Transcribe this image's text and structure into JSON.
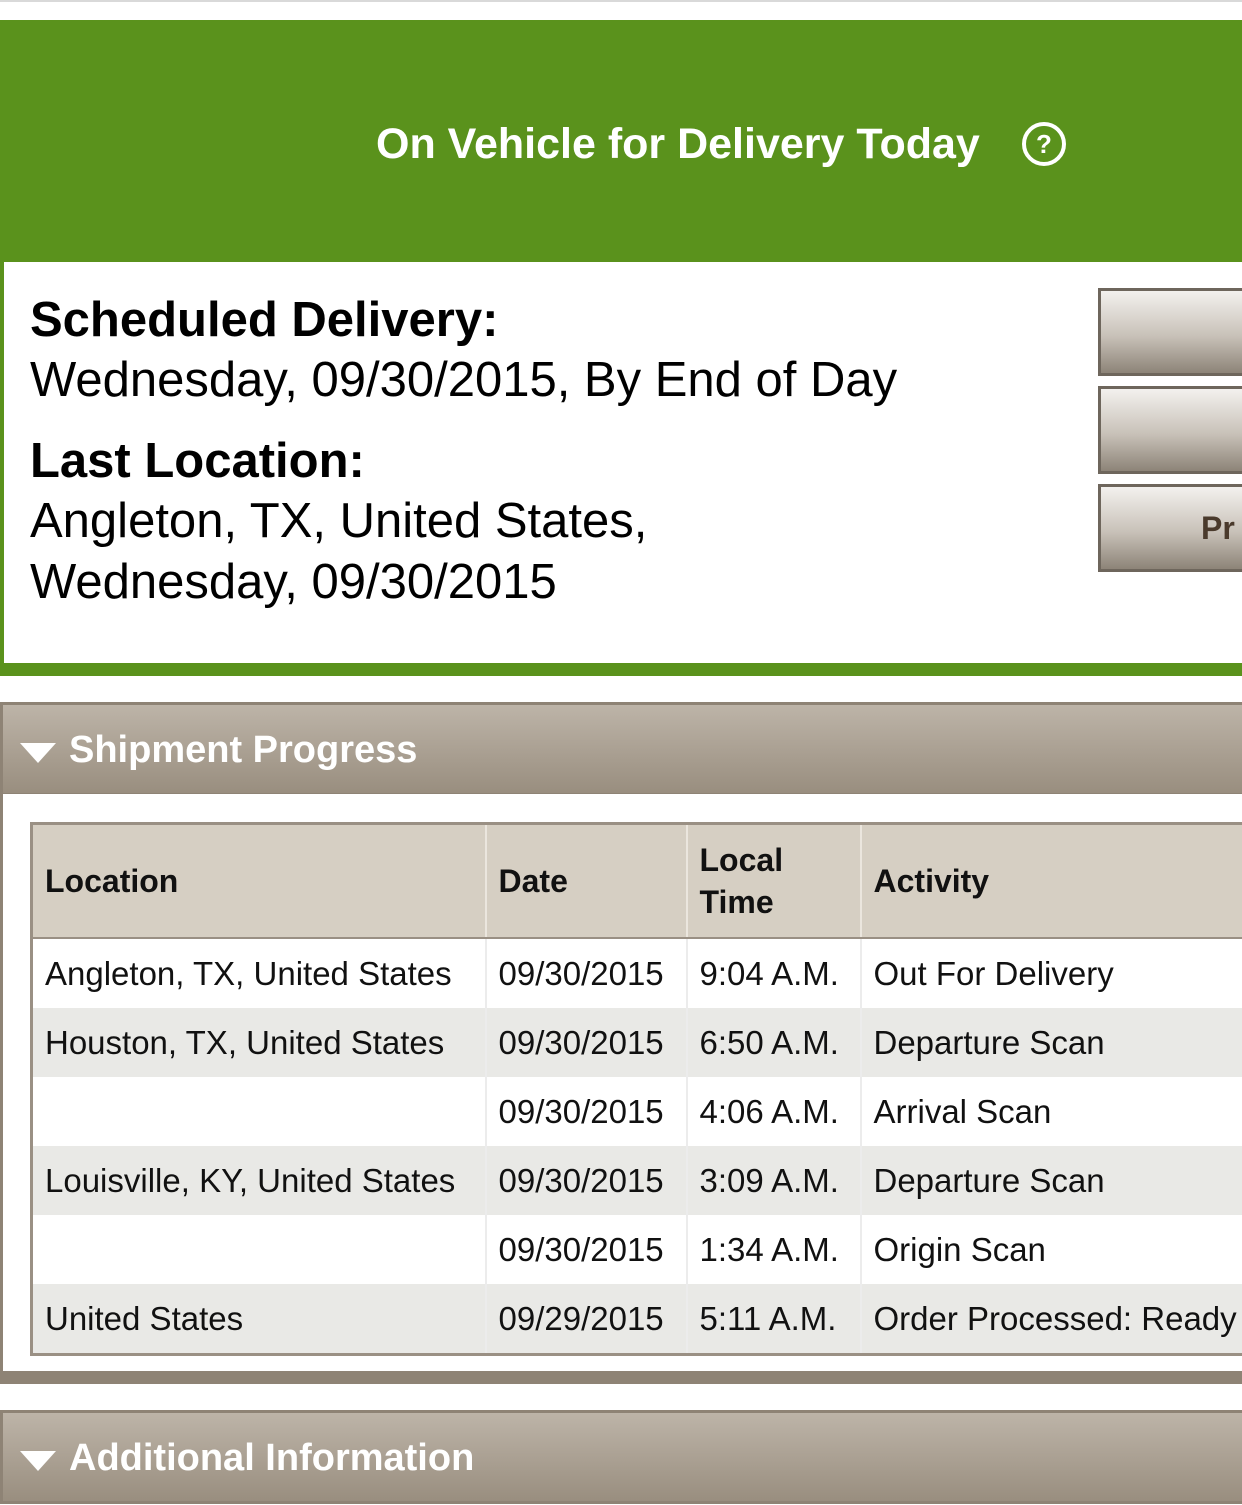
{
  "status": {
    "title": "On Vehicle for Delivery Today",
    "help_icon": "question-circle-icon",
    "accent_color": "#5a921c"
  },
  "delivery": {
    "scheduled_label": "Scheduled Delivery:",
    "scheduled_value": "Wednesday, 09/30/2015, By End of Day",
    "last_location_label": "Last Location:",
    "last_location_line1": "Angleton, TX, United States,",
    "last_location_line2": "Wednesday, 09/30/2015"
  },
  "side_buttons": [
    "",
    "",
    "Pr"
  ],
  "shipment_progress": {
    "title": "Shipment Progress",
    "columns": [
      "Location",
      "Date",
      "Local Time",
      "Activity"
    ],
    "rows": [
      {
        "location": "Angleton, TX, United States",
        "date": "09/30/2015",
        "time": "9:04 A.M.",
        "activity": "Out For Delivery"
      },
      {
        "location": "Houston, TX, United States",
        "date": "09/30/2015",
        "time": "6:50 A.M.",
        "activity": "Departure Scan"
      },
      {
        "location": "",
        "date": "09/30/2015",
        "time": "4:06 A.M.",
        "activity": "Arrival Scan"
      },
      {
        "location": "Louisville, KY, United States",
        "date": "09/30/2015",
        "time": "3:09 A.M.",
        "activity": "Departure Scan"
      },
      {
        "location": "",
        "date": "09/30/2015",
        "time": "1:34 A.M.",
        "activity": "Origin Scan"
      },
      {
        "location": "United States",
        "date": "09/29/2015",
        "time": "5:11 A.M.",
        "activity": "Order Processed: Ready"
      }
    ]
  },
  "additional_info": {
    "title": "Additional Information"
  }
}
